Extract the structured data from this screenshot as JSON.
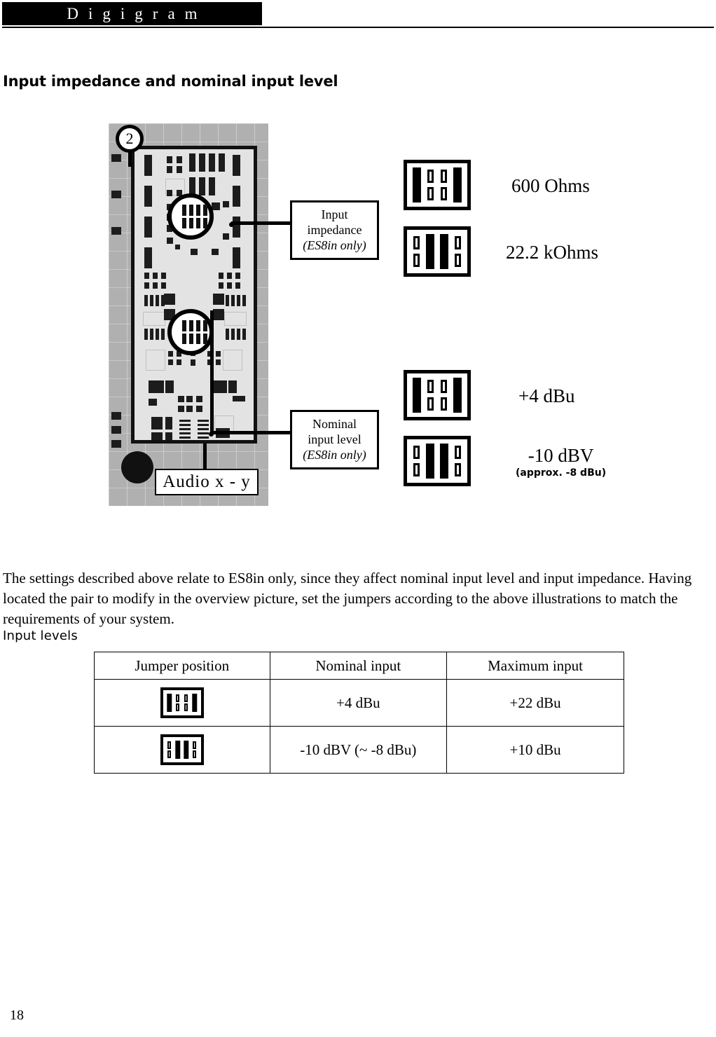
{
  "header": {
    "brand": "Digigram"
  },
  "page": {
    "section_title": "Input impedance and nominal input level",
    "page_number": "18"
  },
  "figure": {
    "callout_number": "2",
    "board_caption": "Audio x - y",
    "labels": [
      {
        "line1": "Input",
        "line2": "impedance",
        "line3": "(ES8in only)"
      },
      {
        "line1": "Nominal",
        "line2": "input level",
        "line3": "(ES8in only)"
      }
    ],
    "jumper_options": [
      {
        "name": "600 Ohms",
        "sub": "",
        "pattern": [
          "closed",
          "open",
          "open",
          "closed"
        ],
        "group": "input-impedance"
      },
      {
        "name": "22.2 kOhms",
        "sub": "",
        "pattern": [
          "open",
          "closed",
          "closed",
          "open"
        ],
        "group": "input-impedance"
      },
      {
        "name": "+4 dBu",
        "sub": "",
        "pattern": [
          "closed",
          "open",
          "open",
          "closed"
        ],
        "group": "nominal-input-level"
      },
      {
        "name": "-10 dBV",
        "sub": "(approx. -8 dBu)",
        "pattern": [
          "open",
          "closed",
          "closed",
          "open"
        ],
        "group": "nominal-input-level"
      }
    ]
  },
  "body": {
    "paragraph": "The settings described above relate to ES8in only, since they affect nominal input level and input impedance. Having located the pair to modify in the overview picture, set the jumpers according to the above illustrations to match the requirements of your system."
  },
  "table_section": {
    "heading": "Input levels",
    "columns": [
      "Jumper position",
      "Nominal input",
      "Maximum input"
    ],
    "rows": [
      {
        "jumper_pattern": [
          "closed",
          "open",
          "open",
          "closed"
        ],
        "nominal_input": "+4 dBu",
        "maximum_input": "+22 dBu"
      },
      {
        "jumper_pattern": [
          "open",
          "closed",
          "closed",
          "open"
        ],
        "nominal_input": "-10 dBV (~ -8 dBu)",
        "maximum_input": "+10 dBu"
      }
    ]
  },
  "colors": {
    "ink": "#000000",
    "paper": "#ffffff",
    "pcb_background": "#b0b0b0",
    "pcb_board": "#e3e3e3"
  }
}
